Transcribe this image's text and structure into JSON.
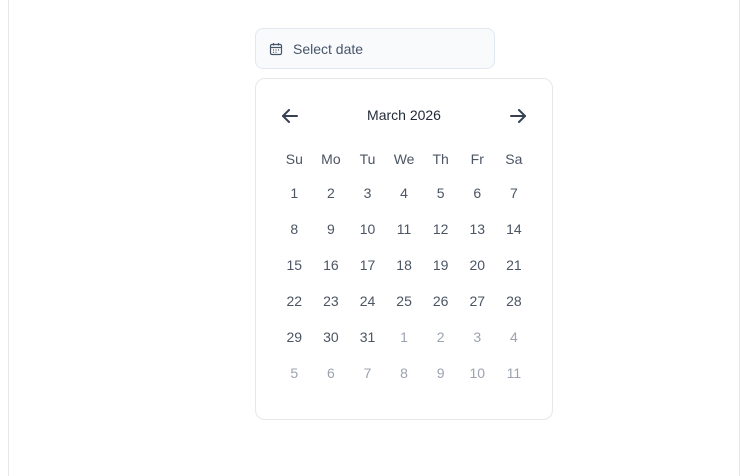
{
  "date_input": {
    "placeholder": "Select date",
    "icon": "calendar-icon"
  },
  "calendar": {
    "month_label": "March 2026",
    "prev_icon": "arrow-left-icon",
    "next_icon": "arrow-right-icon",
    "weekdays": [
      "Su",
      "Mo",
      "Tu",
      "We",
      "Th",
      "Fr",
      "Sa"
    ],
    "weeks": [
      [
        {
          "d": "1",
          "o": false
        },
        {
          "d": "2",
          "o": false
        },
        {
          "d": "3",
          "o": false
        },
        {
          "d": "4",
          "o": false
        },
        {
          "d": "5",
          "o": false
        },
        {
          "d": "6",
          "o": false
        },
        {
          "d": "7",
          "o": false
        }
      ],
      [
        {
          "d": "8",
          "o": false
        },
        {
          "d": "9",
          "o": false
        },
        {
          "d": "10",
          "o": false
        },
        {
          "d": "11",
          "o": false
        },
        {
          "d": "12",
          "o": false
        },
        {
          "d": "13",
          "o": false
        },
        {
          "d": "14",
          "o": false
        }
      ],
      [
        {
          "d": "15",
          "o": false
        },
        {
          "d": "16",
          "o": false
        },
        {
          "d": "17",
          "o": false
        },
        {
          "d": "18",
          "o": false
        },
        {
          "d": "19",
          "o": false
        },
        {
          "d": "20",
          "o": false
        },
        {
          "d": "21",
          "o": false
        }
      ],
      [
        {
          "d": "22",
          "o": false
        },
        {
          "d": "23",
          "o": false
        },
        {
          "d": "24",
          "o": false
        },
        {
          "d": "25",
          "o": false
        },
        {
          "d": "26",
          "o": false
        },
        {
          "d": "27",
          "o": false
        },
        {
          "d": "28",
          "o": false
        }
      ],
      [
        {
          "d": "29",
          "o": false
        },
        {
          "d": "30",
          "o": false
        },
        {
          "d": "31",
          "o": false
        },
        {
          "d": "1",
          "o": true
        },
        {
          "d": "2",
          "o": true
        },
        {
          "d": "3",
          "o": true
        },
        {
          "d": "4",
          "o": true
        }
      ],
      [
        {
          "d": "5",
          "o": true
        },
        {
          "d": "6",
          "o": true
        },
        {
          "d": "7",
          "o": true
        },
        {
          "d": "8",
          "o": true
        },
        {
          "d": "9",
          "o": true
        },
        {
          "d": "10",
          "o": true
        },
        {
          "d": "11",
          "o": true
        }
      ]
    ]
  },
  "colors": {
    "text": "#1f2937",
    "muted": "#9ca3af",
    "input_bg": "#f8fafc",
    "border": "#e5e7eb"
  }
}
